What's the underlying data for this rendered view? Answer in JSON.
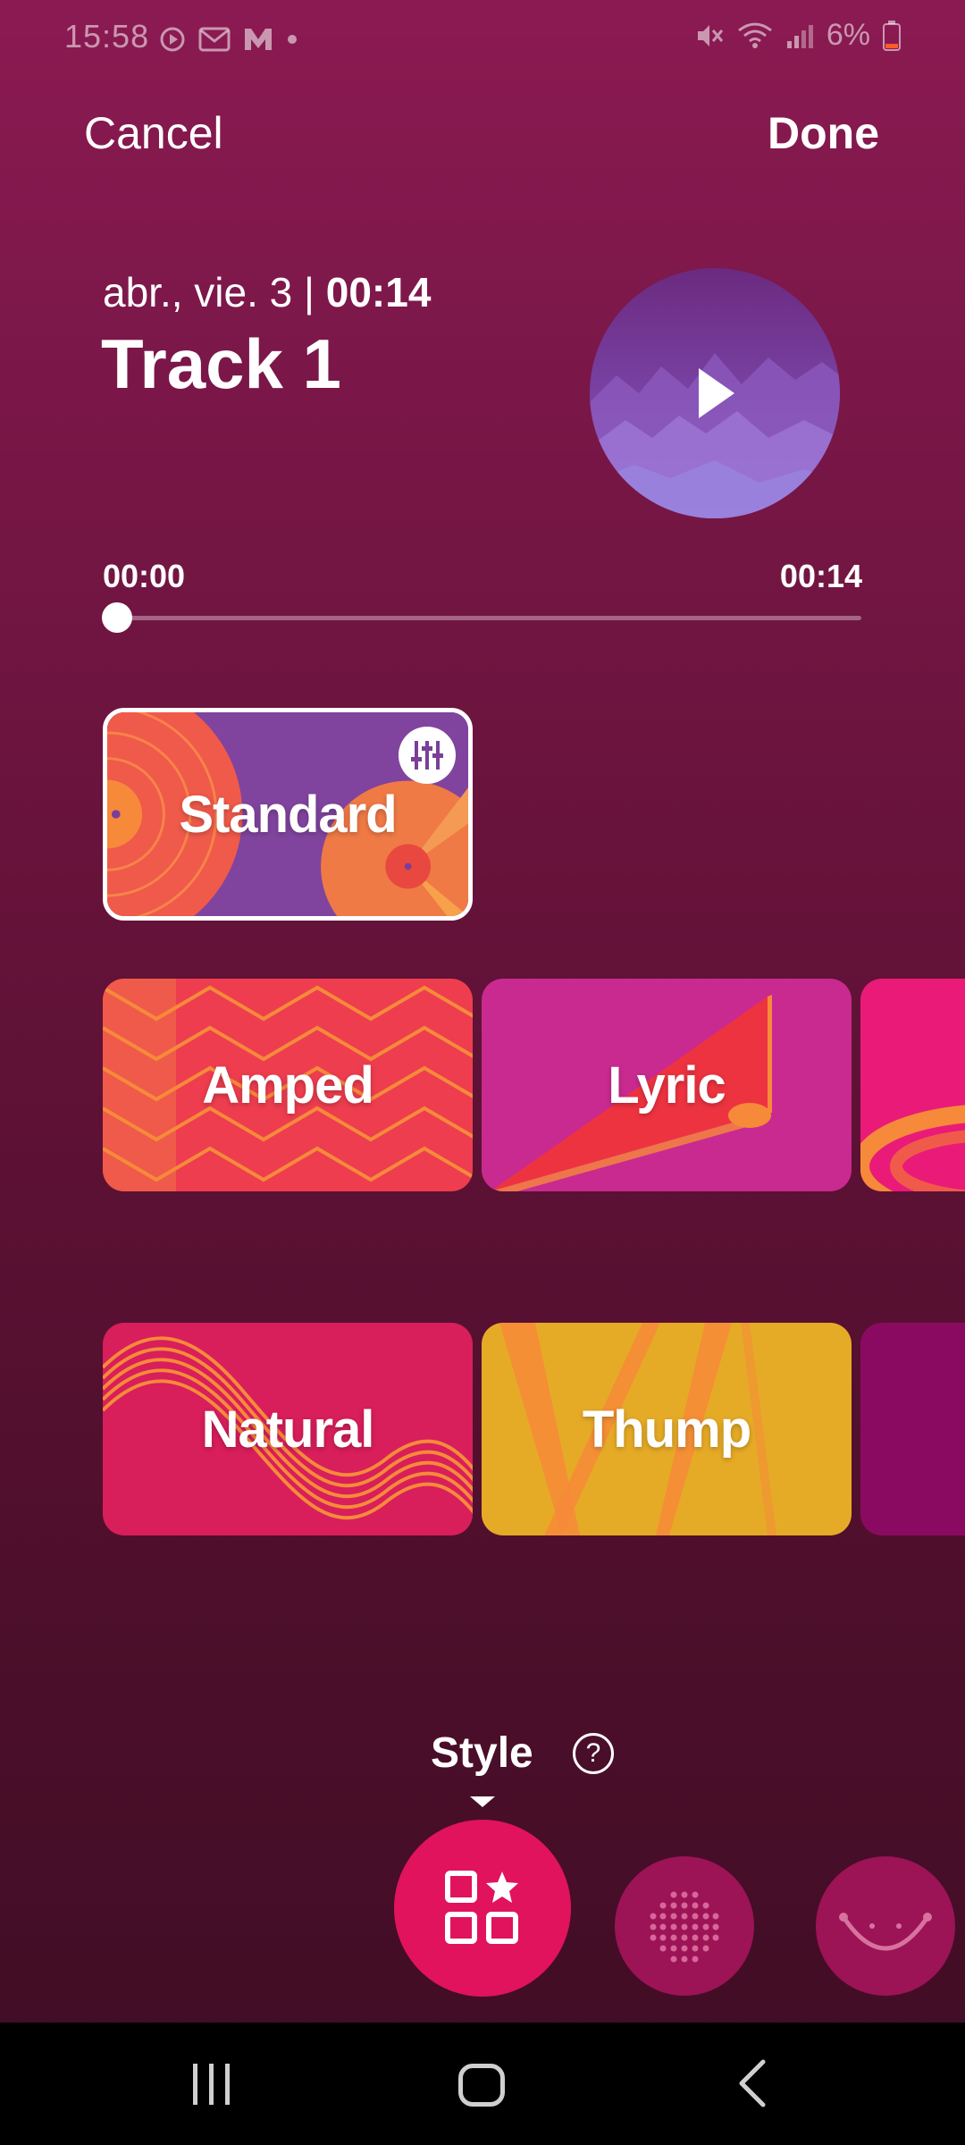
{
  "status_bar": {
    "time": "15:58",
    "battery": "6%",
    "left_icons": [
      "play-circle-icon",
      "gmail-icon",
      "marvel-icon",
      "dot-icon"
    ],
    "right_icons": [
      "mute-icon",
      "wifi-icon",
      "signal-icon",
      "battery-low-icon"
    ]
  },
  "header": {
    "cancel_label": "Cancel",
    "done_label": "Done"
  },
  "track": {
    "date": "abr., vie. 3 | ",
    "duration": "00:14",
    "title": "Track 1"
  },
  "player": {
    "current_time": "00:00",
    "total_time": "00:14",
    "progress": 0.0
  },
  "styles": {
    "selected": "Standard",
    "items": [
      {
        "label": "Standard"
      },
      {
        "label": "Amped"
      },
      {
        "label": "Lyric"
      },
      {
        "label": "Natural"
      },
      {
        "label": "Thump"
      }
    ]
  },
  "bottom": {
    "mode_label": "Style",
    "help_symbol": "?",
    "tools": [
      "style-tool",
      "dots-tool",
      "smile-tool"
    ]
  },
  "colors": {
    "accent": "#e0135c",
    "bg_top": "#8b1a52",
    "bg_bottom": "#3f0c24"
  }
}
